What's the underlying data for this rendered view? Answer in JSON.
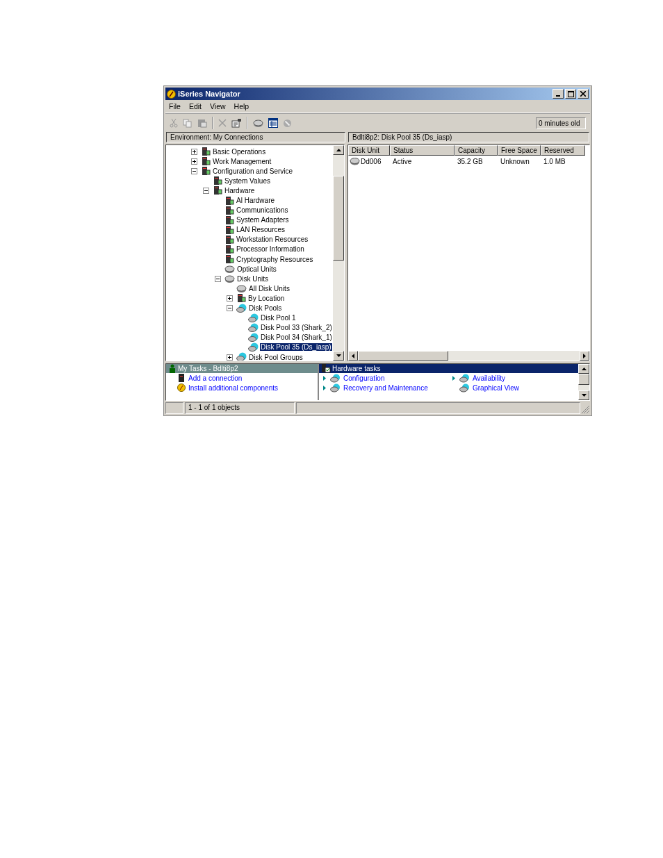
{
  "window": {
    "title": "iSeries Navigator"
  },
  "menu": [
    "File",
    "Edit",
    "View",
    "Help"
  ],
  "toolbar": {
    "age": "0 minutes old"
  },
  "left_header": "Environment: My Connections",
  "right_header": "Bdlti8p2:  Disk Pool 35 (Ds_iasp)",
  "tree": [
    {
      "label": "Basic Operations",
      "kind": "system",
      "expanded": false,
      "selected": false
    },
    {
      "label": "Work Management",
      "kind": "system",
      "expanded": false,
      "selected": false
    },
    {
      "label": "Configuration and Service",
      "kind": "system",
      "expanded": true,
      "selected": false,
      "children": [
        {
          "label": "System Values",
          "kind": "system",
          "selected": false
        },
        {
          "label": "Hardware",
          "kind": "system",
          "expanded": true,
          "selected": false,
          "children": [
            {
              "label": "Al Hardware",
              "kind": "system",
              "selected": false
            },
            {
              "label": "Communications",
              "kind": "system",
              "selected": false
            },
            {
              "label": "System Adapters",
              "kind": "system",
              "selected": false
            },
            {
              "label": "LAN Resources",
              "kind": "system",
              "selected": false
            },
            {
              "label": "Workstation Resources",
              "kind": "system",
              "selected": false
            },
            {
              "label": "Processor Information",
              "kind": "system",
              "selected": false
            },
            {
              "label": "Cryptography Resources",
              "kind": "system",
              "selected": false
            },
            {
              "label": "Optical Units",
              "kind": "disk",
              "selected": false
            },
            {
              "label": "Disk Units",
              "kind": "disk",
              "expanded": true,
              "selected": false,
              "children": [
                {
                  "label": "All Disk Units",
                  "kind": "disk",
                  "selected": false
                },
                {
                  "label": "By Location",
                  "kind": "system",
                  "expanded": false,
                  "selected": false
                },
                {
                  "label": "Disk Pools",
                  "kind": "pool",
                  "expanded": true,
                  "selected": false,
                  "children": [
                    {
                      "label": "Disk Pool 1",
                      "kind": "pool",
                      "selected": false
                    },
                    {
                      "label": "Disk Pool 33 (Shark_2)",
                      "kind": "pool",
                      "selected": false
                    },
                    {
                      "label": "Disk Pool 34 (Shark_1)",
                      "kind": "pool",
                      "selected": false
                    },
                    {
                      "label": "Disk Pool 35 (Ds_iasp)",
                      "kind": "pool",
                      "selected": true
                    }
                  ]
                },
                {
                  "label": "Disk Pool Groups",
                  "kind": "pool",
                  "expanded": false,
                  "selected": false
                }
              ]
            }
          ]
        }
      ]
    }
  ],
  "table": {
    "columns": [
      "Disk Unit",
      "Status",
      "Capacity",
      "Free Space",
      "Reserved"
    ],
    "rows": [
      {
        "cells": [
          "Dd006",
          "Active",
          "35.2 GB",
          "Unknown",
          "1.0 MB"
        ],
        "selected": false
      }
    ]
  },
  "my_tasks": {
    "title": "My Tasks - Bdlti8p2",
    "active": false,
    "links": [
      "Add a connection",
      "Install additional components"
    ]
  },
  "hardware_tasks": {
    "title": "Hardware tasks",
    "active": true,
    "links": [
      {
        "label": "Configuration",
        "expandable": true
      },
      {
        "label": "Availability",
        "expandable": true
      },
      {
        "label": "Recovery and Maintenance",
        "expandable": true
      },
      {
        "label": "Graphical View",
        "expandable": false
      }
    ]
  },
  "status_bar": {
    "text": "1 - 1 of 1 objects"
  }
}
